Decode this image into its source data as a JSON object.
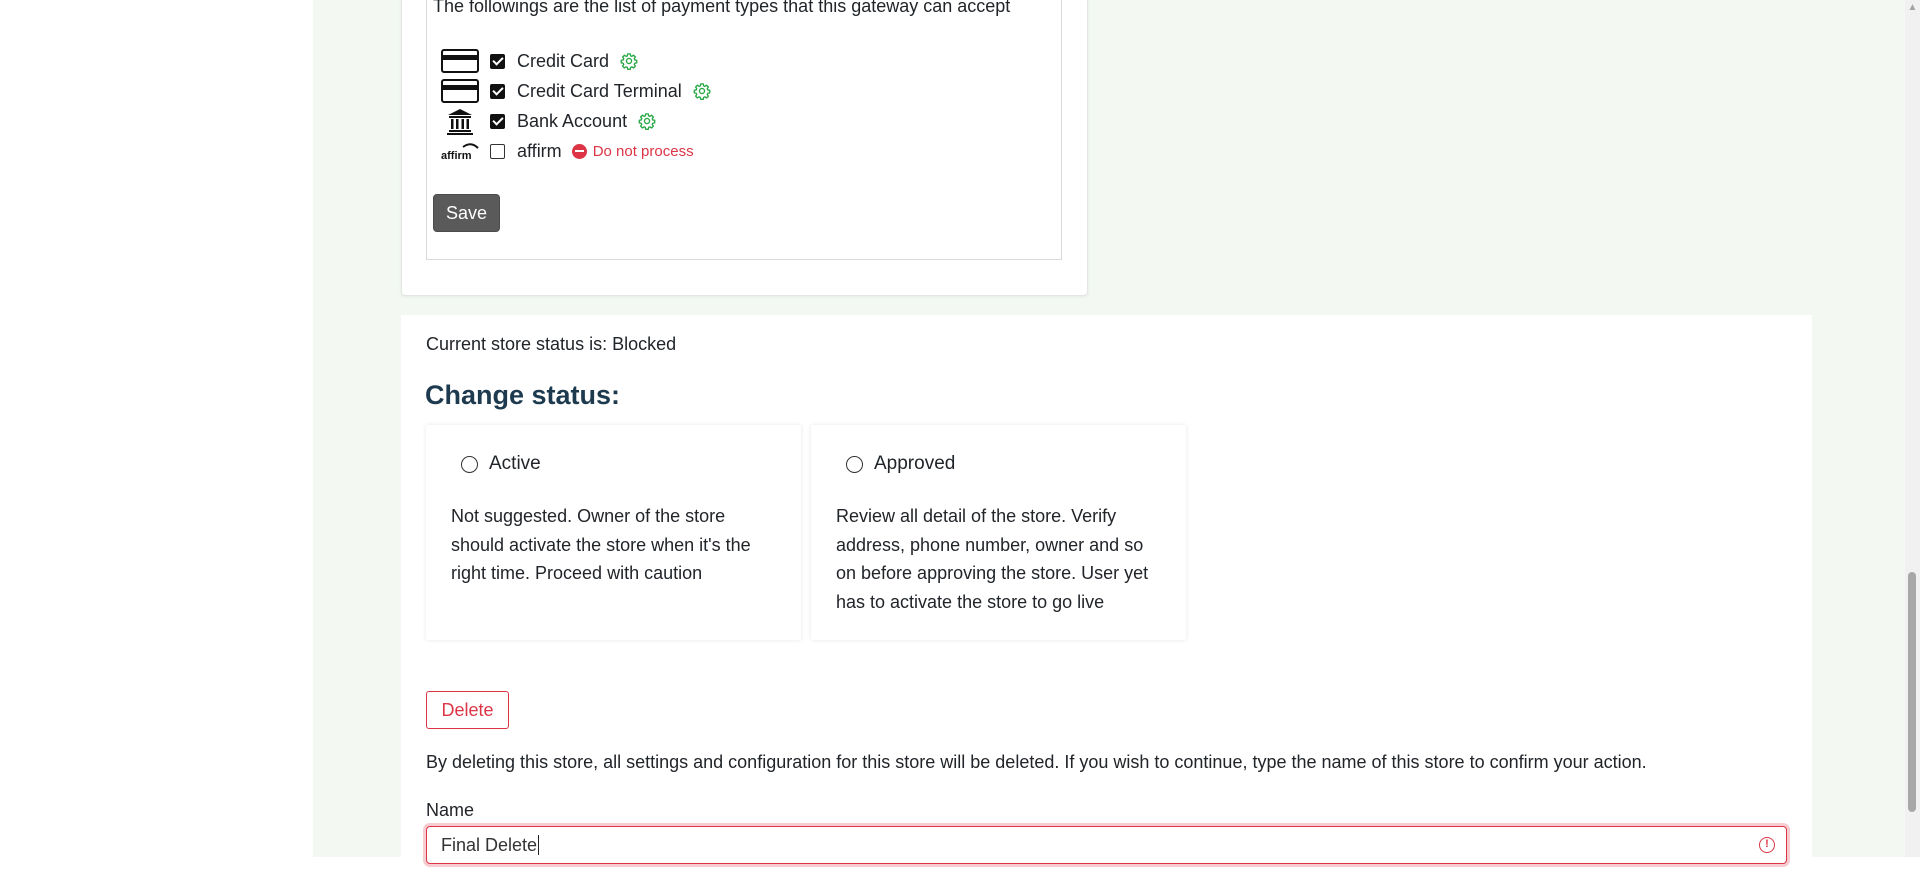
{
  "payment": {
    "intro": "The followings are the list of payment types that this gateway can accept",
    "types": [
      {
        "label": "Credit Card",
        "checked": true,
        "icon": "credit-card-icon",
        "has_settings": true
      },
      {
        "label": "Credit Card Terminal",
        "checked": true,
        "icon": "credit-card-terminal-icon",
        "has_settings": true
      },
      {
        "label": "Bank Account",
        "checked": true,
        "icon": "bank-icon",
        "has_settings": true
      },
      {
        "label": "affirm",
        "checked": false,
        "icon": "affirm-logo",
        "logo_text": "affirm",
        "status": "Do not process"
      }
    ],
    "save_label": "Save"
  },
  "status": {
    "current": "Current store status is: Blocked",
    "heading": "Change status:",
    "options": [
      {
        "label": "Active",
        "selected": false,
        "description": "Not suggested. Owner of the store should activate the store when it's the right time. Proceed with caution"
      },
      {
        "label": "Approved",
        "selected": false,
        "description": "Review all detail of the store. Verify address, phone number, owner and so on before approving the store. User yet has to activate the store to go live"
      }
    ]
  },
  "delete": {
    "button_label": "Delete",
    "info": "By deleting this store, all settings and configuration for this store will be deleted. If you wish to continue, type the name of this store to confirm your action.",
    "name_label": "Name",
    "name_value": "Final Delete",
    "error_icon_text": "!"
  },
  "colors": {
    "accent_green": "#28a745",
    "danger": "#dc3545",
    "save_button": "#5a5a5a",
    "heading": "#1e3a4f",
    "page_bg": "#f3f9f2"
  }
}
